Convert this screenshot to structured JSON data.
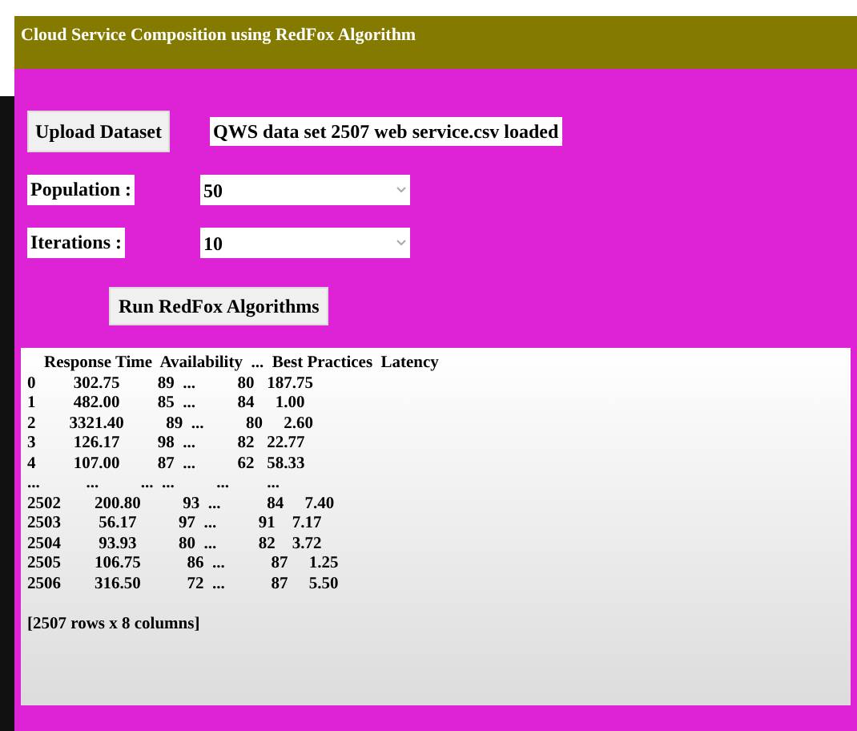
{
  "window": {
    "title": "Cloud Service Composition using RedFox Algorithm"
  },
  "upload_button": "Upload Dataset",
  "status": "QWS data set 2507 web service.csv loaded",
  "fields": [
    {
      "label": "Population :",
      "value": "50"
    },
    {
      "label": "Iterations :",
      "value": "10"
    }
  ],
  "run_button": "Run RedFox Algorithms",
  "output_lines": [
    "    Response Time  Availability  ...  Best Practices  Latency",
    "0         302.75         89  ...          80   187.75",
    "1         482.00         85  ...          84     1.00",
    "2        3321.40          89  ...          80     2.60",
    "3         126.17         98  ...          82   22.77",
    "4         107.00         87  ...          62   58.33",
    "...           ...          ...  ...          ...         ...",
    "2502        200.80          93  ...           84     7.40",
    "2503         56.17          97  ...          91    7.17",
    "2504         93.93          80  ...          82    3.72",
    "2505        106.75           86  ...           87     1.25",
    "2506        316.50           72  ...           87     5.50",
    "[2507 rows x 8 columns]"
  ]
}
